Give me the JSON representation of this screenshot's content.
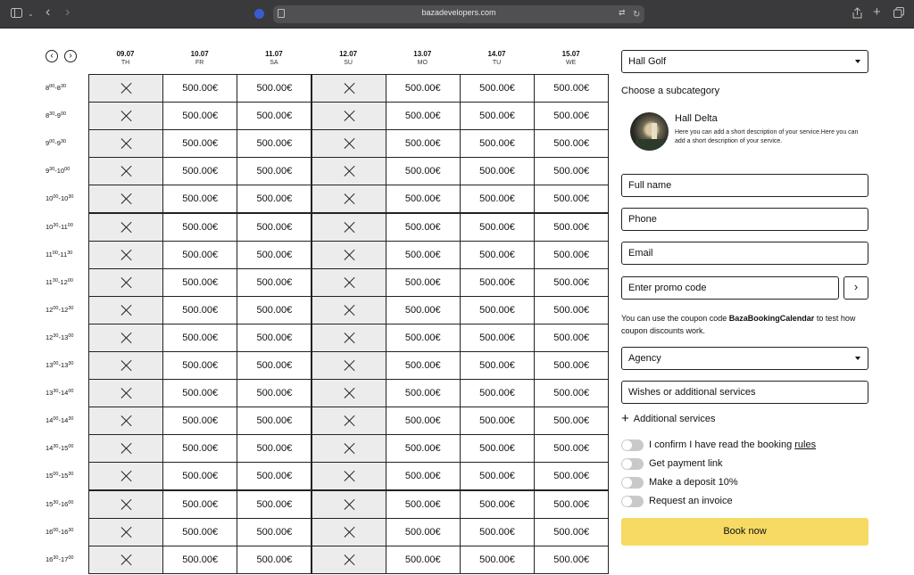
{
  "browser": {
    "url": "bazadevelopers.com",
    "sidebar_icon": "sidebar-icon",
    "back_icon": "chevron-left-icon",
    "forward_icon": "chevron-right-icon",
    "share_icon": "share-icon",
    "new_tab_icon": "plus-icon",
    "tabs_icon": "tabs-icon"
  },
  "calendar": {
    "prev_icon": "‹",
    "next_icon": "›",
    "days": [
      {
        "date": "09.07",
        "name": "TH",
        "closed": true
      },
      {
        "date": "10.07",
        "name": "FR",
        "closed": false
      },
      {
        "date": "11.07",
        "name": "SA",
        "closed": false
      },
      {
        "date": "12.07",
        "name": "SU",
        "closed": true
      },
      {
        "date": "13.07",
        "name": "MO",
        "closed": false
      },
      {
        "date": "14.07",
        "name": "TU",
        "closed": false
      },
      {
        "date": "15.07",
        "name": "WE",
        "closed": false
      }
    ],
    "slots": [
      {
        "start_h": "8",
        "start_m": "00",
        "end_h": "8",
        "end_m": "30"
      },
      {
        "start_h": "8",
        "start_m": "30",
        "end_h": "9",
        "end_m": "00"
      },
      {
        "start_h": "9",
        "start_m": "00",
        "end_h": "9",
        "end_m": "30"
      },
      {
        "start_h": "9",
        "start_m": "30",
        "end_h": "10",
        "end_m": "00"
      },
      {
        "start_h": "10",
        "start_m": "00",
        "end_h": "10",
        "end_m": "30"
      },
      {
        "start_h": "10",
        "start_m": "30",
        "end_h": "11",
        "end_m": "00"
      },
      {
        "start_h": "11",
        "start_m": "00",
        "end_h": "11",
        "end_m": "30"
      },
      {
        "start_h": "11",
        "start_m": "30",
        "end_h": "12",
        "end_m": "00"
      },
      {
        "start_h": "12",
        "start_m": "00",
        "end_h": "12",
        "end_m": "30"
      },
      {
        "start_h": "12",
        "start_m": "30",
        "end_h": "13",
        "end_m": "00"
      },
      {
        "start_h": "13",
        "start_m": "00",
        "end_h": "13",
        "end_m": "30"
      },
      {
        "start_h": "13",
        "start_m": "30",
        "end_h": "14",
        "end_m": "00"
      },
      {
        "start_h": "14",
        "start_m": "00",
        "end_h": "14",
        "end_m": "30"
      },
      {
        "start_h": "14",
        "start_m": "30",
        "end_h": "15",
        "end_m": "00"
      },
      {
        "start_h": "15",
        "start_m": "00",
        "end_h": "15",
        "end_m": "30"
      },
      {
        "start_h": "15",
        "start_m": "30",
        "end_h": "16",
        "end_m": "00"
      },
      {
        "start_h": "16",
        "start_m": "00",
        "end_h": "16",
        "end_m": "30"
      },
      {
        "start_h": "16",
        "start_m": "30",
        "end_h": "17",
        "end_m": "00"
      }
    ],
    "price": "500.00€"
  },
  "panel": {
    "hall_select": "Hall Golf",
    "subcategory_title": "Choose a subcategory",
    "hall_name": "Hall Delta",
    "hall_description": "Here you can add a short description of your service.Here you can add a short description of your service.",
    "full_name_placeholder": "Full name",
    "phone_placeholder": "Phone",
    "email_placeholder": "Email",
    "promo_placeholder": "Enter promo code",
    "promo_button": "›",
    "coupon_prefix": "You can use the coupon code ",
    "coupon_code": "BazaBookingCalendar",
    "coupon_suffix": " to test how coupon discounts work.",
    "agency_select": "Agency",
    "wishes_placeholder": "Wishes or additional services",
    "additional_services": "Additional services",
    "confirm_prefix": "I confirm I have read the booking ",
    "confirm_link": "rules",
    "payment_link": "Get payment link",
    "deposit": "Make a deposit 10%",
    "invoice": "Request an invoice",
    "book_button": "Book now"
  }
}
